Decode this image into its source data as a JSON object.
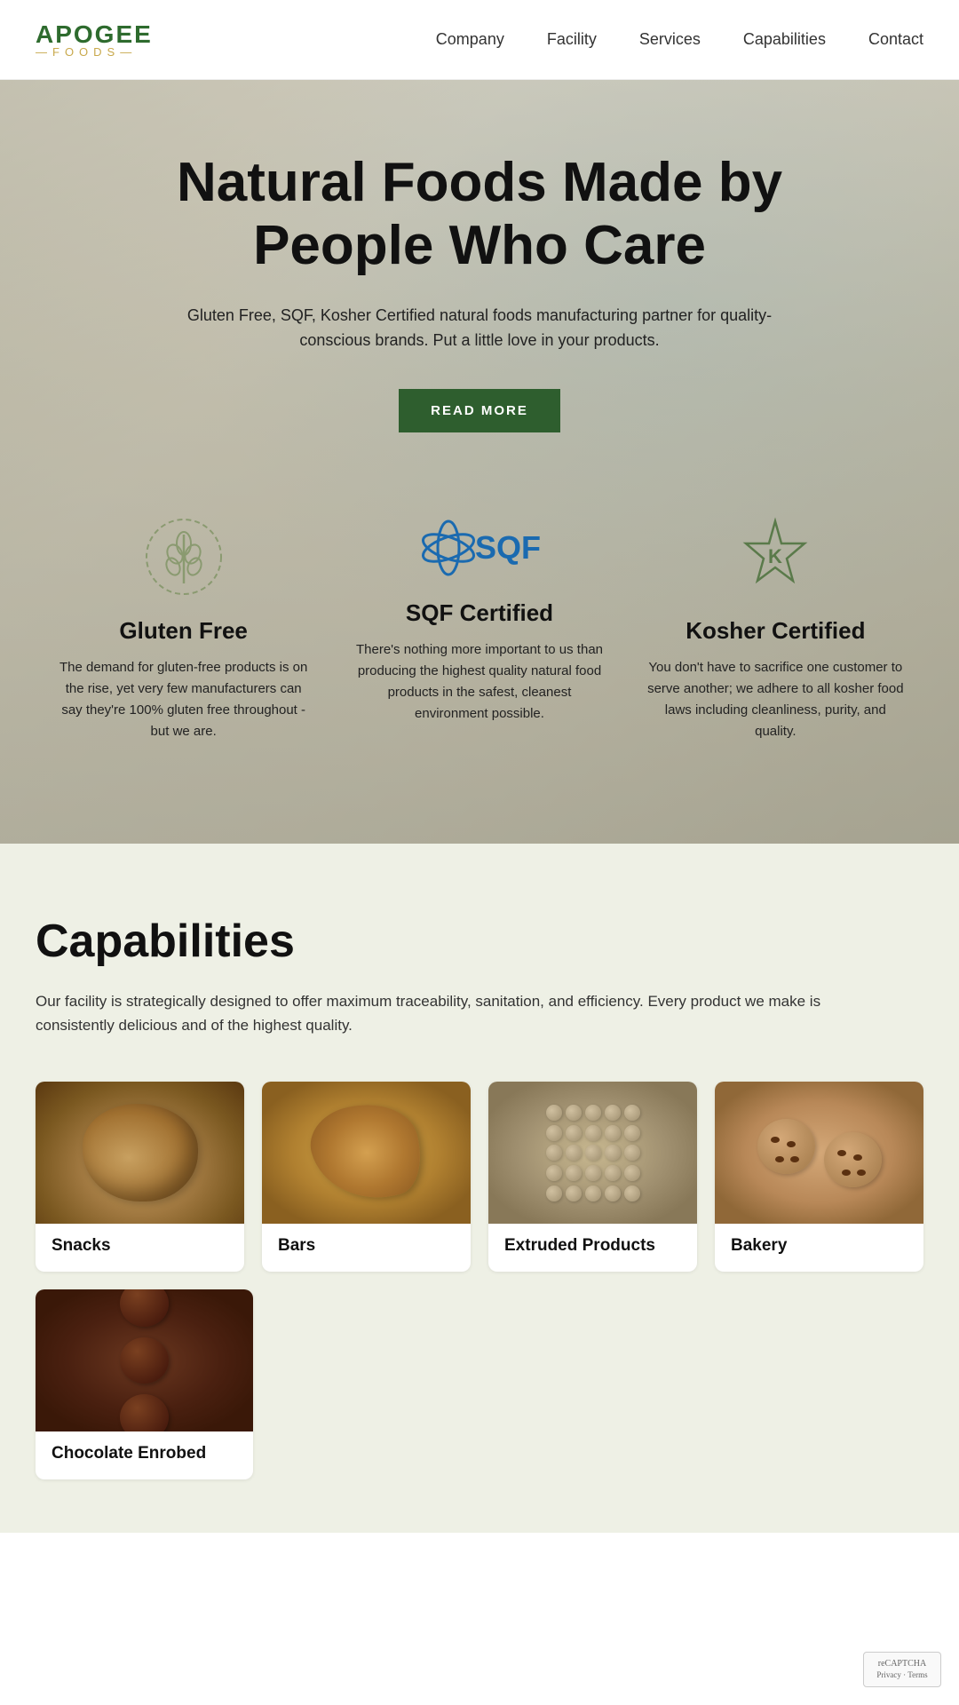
{
  "header": {
    "logo_apogee": "APOGEE",
    "logo_foods": "—FOODS—",
    "nav": [
      {
        "label": "Company",
        "id": "nav-company"
      },
      {
        "label": "Facility",
        "id": "nav-facility"
      },
      {
        "label": "Services",
        "id": "nav-services"
      },
      {
        "label": "Capabilities",
        "id": "nav-capabilities"
      },
      {
        "label": "Contact",
        "id": "nav-contact"
      }
    ]
  },
  "hero": {
    "title": "Natural Foods Made by People Who Care",
    "subtitle": "Gluten Free, SQF, Kosher Certified natural foods manufacturing partner for quality-conscious brands. Put a little love in your products.",
    "cta_label": "READ MORE"
  },
  "certifications": [
    {
      "id": "cert-gluten-free",
      "icon": "gluten-free-icon",
      "title": "Gluten Free",
      "description": "The demand for gluten-free products is on the rise, yet very few manufacturers can say they're 100% gluten free throughout - but we are."
    },
    {
      "id": "cert-sqf",
      "icon": "sqf-icon",
      "title": "SQF Certified",
      "description": "There's nothing more important to us than producing the highest quality natural food products in the safest, cleanest environment possible."
    },
    {
      "id": "cert-kosher",
      "icon": "kosher-icon",
      "title": "Kosher Certified",
      "description": "You don't have to sacrifice one customer to serve another; we adhere to all kosher food laws including cleanliness, purity, and quality."
    }
  ],
  "capabilities": {
    "section_title": "Capabilities",
    "description": "Our facility is strategically designed to offer maximum traceability, sanitation, and efficiency. Every product we make is consistently delicious and of the highest quality.",
    "products": [
      {
        "id": "prod-snacks",
        "label": "Snacks",
        "img_type": "snacks"
      },
      {
        "id": "prod-bars",
        "label": "Bars",
        "img_type": "bars"
      },
      {
        "id": "prod-extruded",
        "label": "Extruded Products",
        "img_type": "extruded"
      },
      {
        "id": "prod-bakery",
        "label": "Bakery",
        "img_type": "bakery"
      },
      {
        "id": "prod-choc",
        "label": "Chocolate Enrobed",
        "img_type": "choc"
      }
    ]
  },
  "recaptcha": {
    "label": "reCAPTCHA\nPrivacy - Terms"
  }
}
